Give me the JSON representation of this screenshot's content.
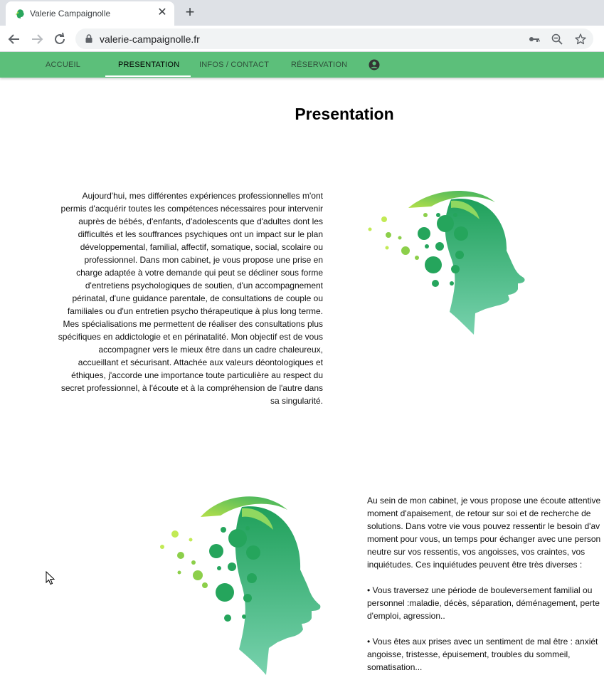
{
  "browser": {
    "tab_title": "Valerie Campaignolle",
    "url": "valerie-campaignolle.fr"
  },
  "nav": {
    "items": [
      "ACCUEIL",
      "PRESENTATION",
      "INFOS / CONTACT",
      "RÉSERVATION"
    ],
    "active_index": 1
  },
  "page": {
    "title": "Presentation",
    "section1_text": "Aujourd'hui, mes différentes expériences professionnelles m'ont permis d'acquérir toutes les compétences nécessaires pour intervenir auprès de bébés, d'enfants, d'adolescents que d'adultes dont les difficultés et les souffrances psychiques ont un impact sur le plan développemental, familial, affectif, somatique, social, scolaire ou professionnel. Dans mon cabinet, je vous propose une prise en charge adaptée à votre demande qui peut se décliner sous forme d'entretiens psychologiques de soutien, d'un accompagnement périnatal, d'une guidance parentale, de consultations de couple ou familiales ou d'un entretien psycho thérapeutique à plus long terme.",
    "section1_text2": "Mes spécialisations me permettent de réaliser des consultations plus spécifiques en addictologie et en périnatalité. Mon objectif est de vous accompagner vers le mieux être dans un cadre chaleureux, accueillant et sécurisant. Attachée aux valeurs déontologiques et éthiques, j'accorde une importance toute particulière au respect du secret professionnel, à l'écoute et à la compréhension de l'autre dans sa singularité.",
    "section2_lines": [
      "Au sein de mon cabinet, je vous propose une écoute attentive",
      "moment d'apaisement, de retour sur soi et de recherche de",
      "solutions. Dans votre vie vous pouvez ressentir le besoin d'av",
      "moment pour vous, un temps pour échanger avec une person",
      "neutre sur vos ressentis, vos angoisses, vos craintes, vos",
      "inquiétudes. Ces inquiétudes peuvent être très diverses :",
      "",
      "• Vous traversez une période de bouleversement familial ou",
      "personnel :maladie, décès, séparation, déménagement, perte",
      "d'emploi, agression..",
      "",
      "• Vous êtes aux prises avec un sentiment de mal être : anxiét",
      "angoisse, tristesse, épuisement, troubles du sommeil,",
      "somatisation..."
    ]
  },
  "icons": {
    "favicon": "head-logo-icon",
    "user": "account-circle-icon"
  },
  "colors": {
    "nav_bg": "#5cbf7a",
    "head_dark": "#1a9a5a",
    "head_light": "#b4e04a"
  }
}
